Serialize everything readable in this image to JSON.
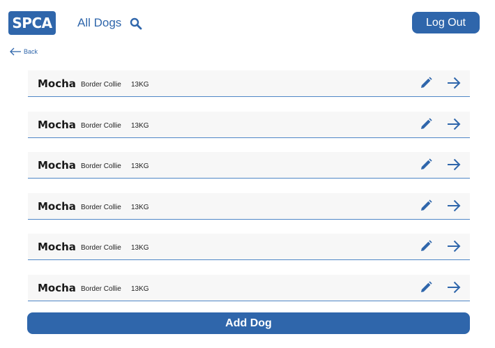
{
  "header": {
    "logo_text": "SPCA",
    "nav_title": "All Dogs",
    "logout_label": "Log Out"
  },
  "back_label": "Back",
  "dogs": [
    {
      "name": "Mocha",
      "breed": "Border Collie",
      "weight": "13KG"
    },
    {
      "name": "Mocha",
      "breed": "Border Collie",
      "weight": "13KG"
    },
    {
      "name": "Mocha",
      "breed": "Border Collie",
      "weight": "13KG"
    },
    {
      "name": "Mocha",
      "breed": "Border Collie",
      "weight": "13KG"
    },
    {
      "name": "Mocha",
      "breed": "Border Collie",
      "weight": "13KG"
    },
    {
      "name": "Mocha",
      "breed": "Border Collie",
      "weight": "13KG"
    }
  ],
  "add_dog_label": "Add Dog",
  "icons": {
    "search": "search-icon",
    "back": "arrow-left-icon",
    "edit": "pencil-icon",
    "open": "arrow-right-icon"
  },
  "colors": {
    "brand": "#2f66ab",
    "row_background": "#f7f7f7",
    "row_underline": "#4f86c6"
  }
}
